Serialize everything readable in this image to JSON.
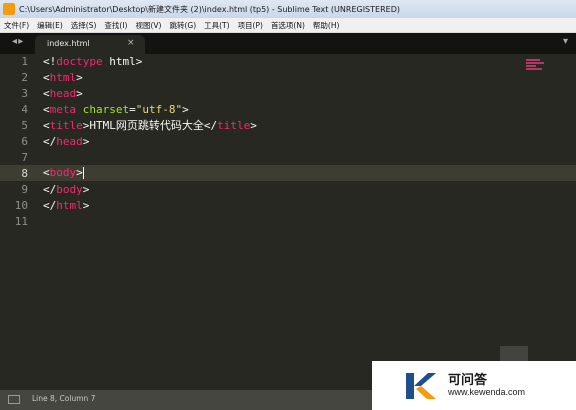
{
  "window": {
    "title": "C:\\Users\\Administrator\\Desktop\\新建文件夹 (2)\\index.html (tp5) - Sublime Text (UNREGISTERED)"
  },
  "menu": [
    "文件(F)",
    "编辑(E)",
    "选择(S)",
    "查找(I)",
    "视图(V)",
    "跳转(G)",
    "工具(T)",
    "项目(P)",
    "首选项(N)",
    "帮助(H)"
  ],
  "tab": {
    "filename": "index.html",
    "close": "×"
  },
  "tabstrip": {
    "nav": "◂ ▸",
    "dropdown": "▾"
  },
  "editor": {
    "line_numbers": [
      "1",
      "2",
      "3",
      "4",
      "5",
      "6",
      "7",
      "8",
      "9",
      "10",
      "11"
    ],
    "current_line": 8,
    "code": {
      "l1_a": "<!",
      "l1_b": "doctype",
      "l1_c": " html>",
      "l2_a": "<",
      "l2_b": "html",
      "l2_c": ">",
      "l3_a": "<",
      "l3_b": "head",
      "l3_c": ">",
      "l4_a": "<",
      "l4_b": "meta",
      "l4_c": " ",
      "l4_d": "charset",
      "l4_e": "=",
      "l4_f": "\"utf-8\"",
      "l4_g": ">",
      "l5_a": "<",
      "l5_b": "title",
      "l5_c": ">HTML网页跳转代码大全</",
      "l5_d": "title",
      "l5_e": ">",
      "l6_a": "</",
      "l6_b": "head",
      "l6_c": ">",
      "l8_a": "<",
      "l8_b": "body",
      "l8_c": ">",
      "l9_a": "</",
      "l9_b": "body",
      "l9_c": ">",
      "l10_a": "</",
      "l10_b": "html",
      "l10_c": ">"
    }
  },
  "status": {
    "position": "Line 8, Column 7"
  },
  "watermark": {
    "cn": "可问答",
    "en": "www.kewenda.com"
  },
  "colors": {
    "background": "#272822",
    "tag": "#f92672",
    "attribute": "#a6e22e",
    "string": "#e6db74",
    "text": "#f8f8f2"
  }
}
